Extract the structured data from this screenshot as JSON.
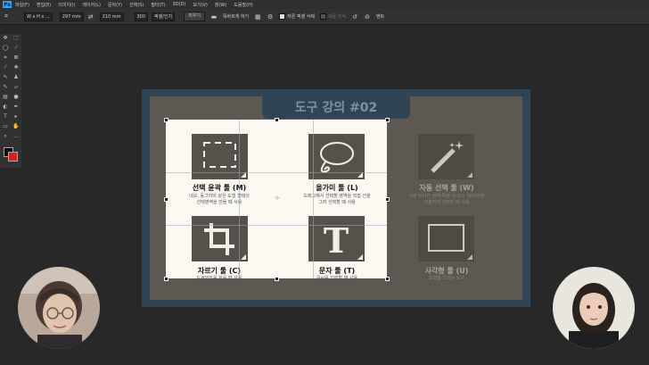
{
  "menu": {
    "items": [
      "파일(F)",
      "편집(E)",
      "이미지(I)",
      "레이어(L)",
      "문자(Y)",
      "선택(S)",
      "필터(T)",
      "3D(D)",
      "보기(V)",
      "창(W)",
      "도움말(H)"
    ]
  },
  "options": {
    "preset": "W x H x ...",
    "width": "297 mm",
    "height": "210 mm",
    "resolution": "300",
    "unit": "픽셀/인치",
    "clear_label": "지우기",
    "straighten_label": "똑바르게 하기",
    "delete_cropped_label": "자른 픽셀 삭제",
    "content_aware_label": "내용 인식",
    "extra_label": "벤트"
  },
  "slide": {
    "title": "도구 강의 #02",
    "tools": [
      {
        "label": "선택 윤곽 툴 (M)",
        "desc": [
          "네모, 동그라미 같은 도형 형태의",
          "선택영역을 만들 때 사용"
        ]
      },
      {
        "label": "올가미 툴 (L)",
        "desc": [
          "드래그해서 선택할 영역을 직접 선을",
          "그려 선택할 때 사용"
        ]
      },
      {
        "label": "자동 선택 툴 (W)",
        "desc": [
          "구분 되어진 영역(특정 색 또는 레이어)을",
          "구분하여 선택할 때 사용"
        ]
      },
      {
        "label": "자르기 툴 (C)",
        "desc": [
          "도큐먼트를 자를 때 사용"
        ]
      },
      {
        "label": "문자 툴 (T)",
        "desc": [
          "글씨를 입력할 때 사용"
        ]
      },
      {
        "label": "사각형 툴 (U)",
        "desc": [
          "도형을 그리는 도구"
        ]
      }
    ]
  },
  "colors": {
    "foreground": "#000000",
    "background": "#e01b1b",
    "frame": "#2f4556",
    "slide": "#5d5852"
  }
}
